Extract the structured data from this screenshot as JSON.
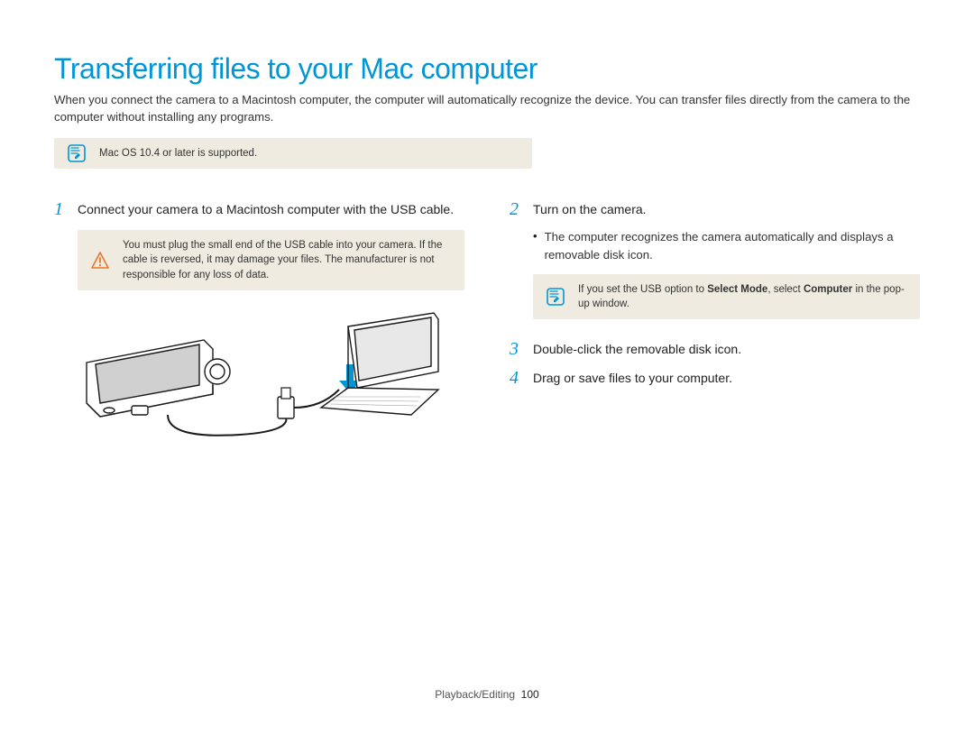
{
  "title": "Transferring files to your Mac computer",
  "intro": "When you connect the camera to a Macintosh computer, the computer will automatically recognize the device. You can transfer files directly from the camera to the computer without installing any programs.",
  "top_note": "Mac OS 10.4 or later is supported.",
  "left": {
    "step1_num": "1",
    "step1_text": "Connect your camera to a Macintosh computer with the USB cable.",
    "warn_text": "You must plug the small end of the USB cable into your camera. If the cable is reversed, it may damage your files. The manufacturer is not responsible for any loss of data."
  },
  "right": {
    "step2_num": "2",
    "step2_text": "Turn on the camera.",
    "bullet_text": "The computer recognizes the camera automatically and displays a removable disk icon.",
    "info_prefix": "If you set the USB option to ",
    "info_bold1": "Select Mode",
    "info_mid": ", select ",
    "info_bold2": "Computer",
    "info_suffix": " in the pop-up window.",
    "step3_num": "3",
    "step3_text": "Double-click the removable disk icon.",
    "step4_num": "4",
    "step4_text": "Drag or save files to your computer."
  },
  "footer_section": "Playback/Editing",
  "footer_page": "100",
  "icons": {
    "note": "note-icon",
    "warning": "warning-icon"
  }
}
